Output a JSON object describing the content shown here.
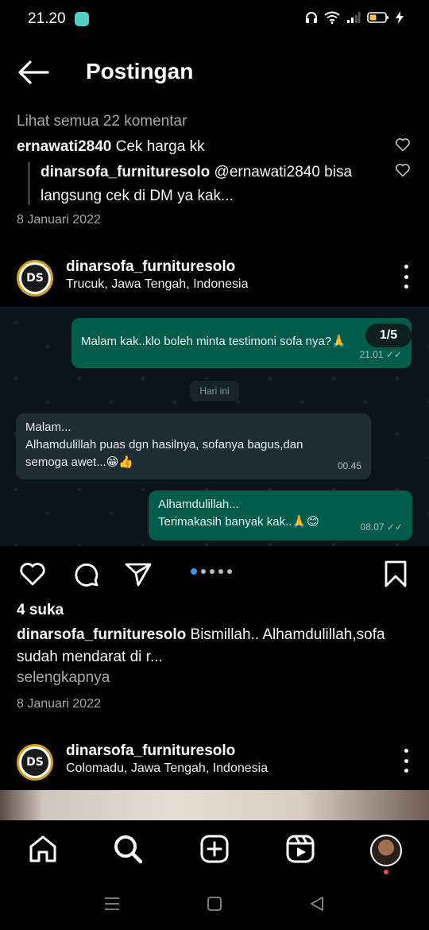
{
  "status": {
    "time": "21.20",
    "icons": [
      "app-notification-icon",
      "headphones-icon",
      "wifi-icon",
      "signal-icon",
      "battery-icon",
      "charging-icon"
    ],
    "battery_color": "#f2c94c"
  },
  "header": {
    "title": "Postingan"
  },
  "comments": {
    "view_all": "Lihat semua 22 komentar",
    "items": [
      {
        "user": "ernawati2840",
        "text": "Cek harga kk"
      },
      {
        "user": "dinarsofa_furnituresolo",
        "text": "@ernawati2840 bisa langsung cek di DM ya kak..."
      }
    ],
    "date": "8 Januari 2022"
  },
  "post1": {
    "avatar_text": "DS",
    "username": "dinarsofa_furnituresolo",
    "location": "Trucuk, Jawa Tengah, Indonesia",
    "counter": "1/5",
    "chat": {
      "messages": [
        {
          "direction": "out",
          "text": "Malam kak..klo boleh minta testimoni sofa nya?🙏",
          "time": "21.01"
        },
        {
          "direction": "in",
          "text": "Malam...\nAlhamdulillah puas dgn hasilnya, sofanya bagus,dan semoga awet...😁👍",
          "time": "00.45"
        },
        {
          "direction": "out",
          "text": "Alhamdulillah...\nTerimakasih banyak kak..🙏😊",
          "time": "08.07"
        }
      ],
      "day_chip": "Hari ini",
      "colors": {
        "outgoing": "#005c4b",
        "incoming": "#202c33",
        "background": "#0b141a"
      }
    },
    "carousel": {
      "total": 5,
      "current": 1,
      "active_color": "#3897f0"
    },
    "likes": "4 suka",
    "caption_user": "dinarsofa_furnituresolo",
    "caption_text": "Bismillah.. Alhamdulillah,sofa sudah mendarat di r...",
    "more": "selengkapnya",
    "date": "8 Januari 2022"
  },
  "post2": {
    "avatar_text": "DS",
    "username": "dinarsofa_furnituresolo",
    "location": "Colomadu, Jawa Tengah, Indonesia"
  },
  "bottom_nav": {
    "items": [
      "home-icon",
      "search-icon",
      "create-icon",
      "reels-icon",
      "profile-avatar"
    ],
    "notification_color": "#ed4956"
  },
  "system_nav": [
    "menu-icon",
    "home-square-icon",
    "back-triangle-icon"
  ]
}
